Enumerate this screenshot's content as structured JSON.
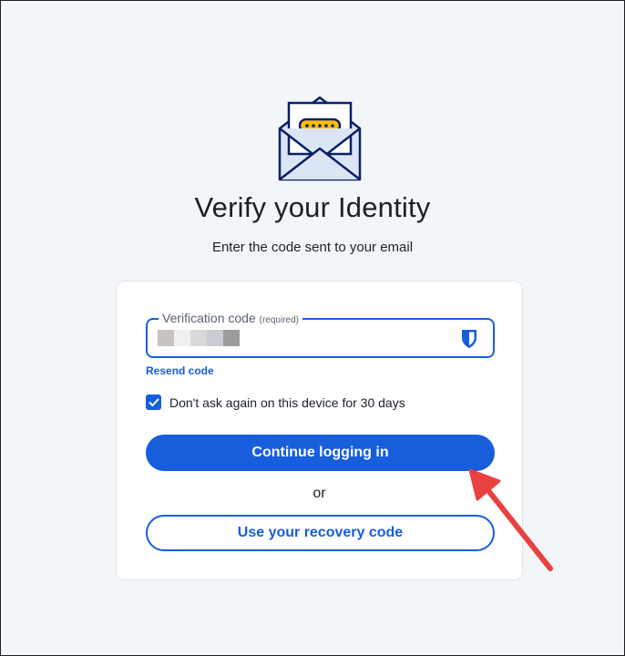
{
  "header": {
    "icon": "envelope-with-code-icon",
    "title": "Verify your Identity",
    "subtitle": "Enter the code sent to your email"
  },
  "form": {
    "field_label": "Verification code",
    "field_required_hint": "(required)",
    "field_value_masked": true,
    "field_icon": "bitwarden-shield-icon",
    "resend_label": "Resend code",
    "remember_label": "Don't ask again on this device for 30 days",
    "remember_checked": true,
    "continue_label": "Continue logging in",
    "or_label": "or",
    "recovery_label": "Use your recovery code"
  },
  "colors": {
    "accent": "#175ddc",
    "background": "#f3f6f9",
    "annotation_arrow": "#e8413f"
  }
}
